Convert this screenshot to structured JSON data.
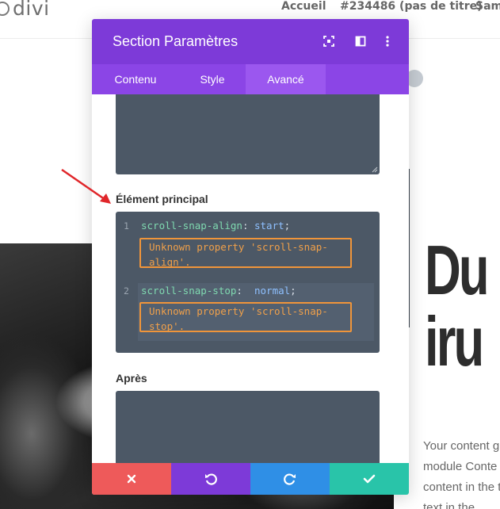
{
  "site": {
    "logo_text": "divi",
    "nav": [
      "Accueil",
      "#234486 (pas de titre)",
      "Sam"
    ],
    "hero_title_line1": "Du",
    "hero_title_line2": "iru",
    "hero_text": "Your content g module Conte content in the this text in the"
  },
  "modal": {
    "title": "Section Paramètres",
    "header_icons": [
      "expand-icon",
      "split-view-icon",
      "more-vertical-icon"
    ],
    "tabs": [
      {
        "label": "Contenu",
        "active": false
      },
      {
        "label": "Style",
        "active": false
      },
      {
        "label": "Avancé",
        "active": true
      }
    ],
    "fields": {
      "main_label": "Élément principal",
      "after_label": "Après"
    },
    "code": {
      "lines": [
        {
          "num": "1",
          "property": "scroll-snap-align",
          "colon": ": ",
          "value": "start",
          "semicolon": ";",
          "error": "Unknown property 'scroll-snap-align'."
        },
        {
          "num": "2",
          "property": "scroll-snap-stop",
          "colon": ":  ",
          "value": "normal",
          "semicolon": ";",
          "error": "Unknown property 'scroll-snap-stop'."
        }
      ]
    },
    "footer": {
      "buttons": [
        "cancel-icon",
        "undo-icon",
        "redo-icon",
        "save-icon"
      ]
    }
  },
  "colors": {
    "header": "#7d3ad8",
    "tabs": "#8b45e6",
    "editor_bg": "#4c5866",
    "lint_border": "#f0953a",
    "cancel": "#ee5a5a",
    "redo": "#2f8fe6",
    "save": "#29c4a9",
    "annotation_arrow": "#e0262a"
  }
}
